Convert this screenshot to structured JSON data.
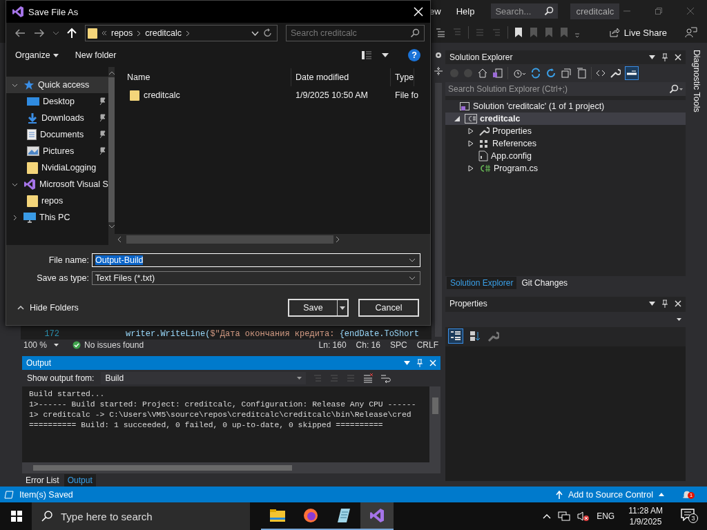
{
  "vs": {
    "menu": [
      "ew",
      "Help"
    ],
    "search_placeholder": "Search...",
    "solution_name": "creditcalc",
    "live_share": "Live Share"
  },
  "editor": {
    "lines": [
      {
        "number": "172",
        "parts": [
          {
            "text": "writer.WriteLine(",
            "kind": "code"
          },
          {
            "text": "$\"Дата окончания кредита: ",
            "kind": "string"
          },
          {
            "text": "{endDate.ToShort",
            "kind": "code"
          }
        ]
      }
    ],
    "status": {
      "zoom": "100 %",
      "issues": "No issues found",
      "line": "Ln: 160",
      "column": "Ch: 16",
      "whitespace": "SPC",
      "line_ending": "CRLF"
    }
  },
  "output": {
    "title": "Output",
    "source_label": "Show output from:",
    "source": "Build",
    "lines": [
      "Build started...",
      "1>------ Build started: Project: creditcalc, Configuration: Release Any CPU ------",
      "1>  creditcalc -> C:\\Users\\VM5\\source\\repos\\creditcalc\\creditcalc\\bin\\Release\\cred",
      "========== Build: 1 succeeded, 0 failed, 0 up-to-date, 0 skipped =========="
    ],
    "tabs": [
      {
        "label": "Error List",
        "selected": false
      },
      {
        "label": "Output",
        "selected": true
      }
    ]
  },
  "solution_explorer": {
    "title": "Solution Explorer",
    "search_placeholder": "Search Solution Explorer (Ctrl+;)",
    "tree": [
      {
        "label": "Solution 'creditcalc' (1 of 1 project)",
        "kind": "solution",
        "selected": false,
        "children": [
          {
            "label": "creditcalc",
            "kind": "project",
            "expanded": true,
            "selected": true,
            "children": [
              {
                "label": "Properties",
                "kind": "properties",
                "expanded": false,
                "selected": false
              },
              {
                "label": "References",
                "kind": "references",
                "expanded": false,
                "selected": false
              },
              {
                "label": "App.config",
                "kind": "config",
                "selected": false
              },
              {
                "label": "Program.cs",
                "kind": "csharp",
                "expanded": false,
                "selected": false
              }
            ]
          }
        ]
      }
    ],
    "tabs": [
      {
        "label": "Solution Explorer",
        "selected": true
      },
      {
        "label": "Git Changes",
        "selected": false
      }
    ]
  },
  "properties": {
    "title": "Properties"
  },
  "side_tab": "Diagnostic Tools",
  "dialog": {
    "title": "Save File As",
    "breadcrumb": [
      "repos",
      "creditcalc"
    ],
    "search_placeholder": "Search creditcalc",
    "organize": "Organize",
    "new_folder": "New folder",
    "help": "?",
    "nav": [
      {
        "label": "Quick access",
        "kind": "star",
        "expanded": true,
        "selected": true,
        "children": [
          {
            "label": "Desktop",
            "kind": "desktop",
            "pinned": true,
            "selected": false
          },
          {
            "label": "Downloads",
            "kind": "downloads",
            "pinned": true,
            "selected": false
          },
          {
            "label": "Documents",
            "kind": "documents",
            "pinned": true,
            "selected": false
          },
          {
            "label": "Pictures",
            "kind": "pictures",
            "pinned": true,
            "selected": false
          },
          {
            "label": "NvidiaLogging",
            "kind": "folder",
            "pinned": false,
            "selected": false
          }
        ]
      },
      {
        "label": "Microsoft Visual S",
        "kind": "vs",
        "expanded": true,
        "selected": false,
        "children": [
          {
            "label": "repos",
            "kind": "folder",
            "selected": false
          }
        ]
      },
      {
        "label": "This PC",
        "kind": "pc",
        "expanded": false,
        "selected": false
      }
    ],
    "columns": [
      "Name",
      "Date modified",
      "Type"
    ],
    "files": [
      {
        "name": "creditcalc",
        "date": "1/9/2025 10:50 AM",
        "type": "File fo"
      }
    ],
    "file_name_label": "File name:",
    "file_name": "Output-Build",
    "type_label": "Save as type:",
    "save_as_type": "Text Files (*.txt)",
    "hide_folders": "Hide Folders",
    "save": "Save",
    "cancel": "Cancel"
  },
  "status_bar": {
    "message": "Item(s) Saved",
    "source_control": "Add to Source Control",
    "notification_count": "1"
  },
  "taskbar": {
    "search_placeholder": "Type here to search",
    "apps": [
      {
        "kind": "explorer",
        "selected": false
      },
      {
        "kind": "firefox",
        "selected": false
      },
      {
        "kind": "notepad",
        "selected": false
      },
      {
        "kind": "vs",
        "selected": true
      }
    ],
    "language": "ENG",
    "time": "11:28 AM",
    "date": "1/9/2025",
    "notification_count": "3"
  }
}
